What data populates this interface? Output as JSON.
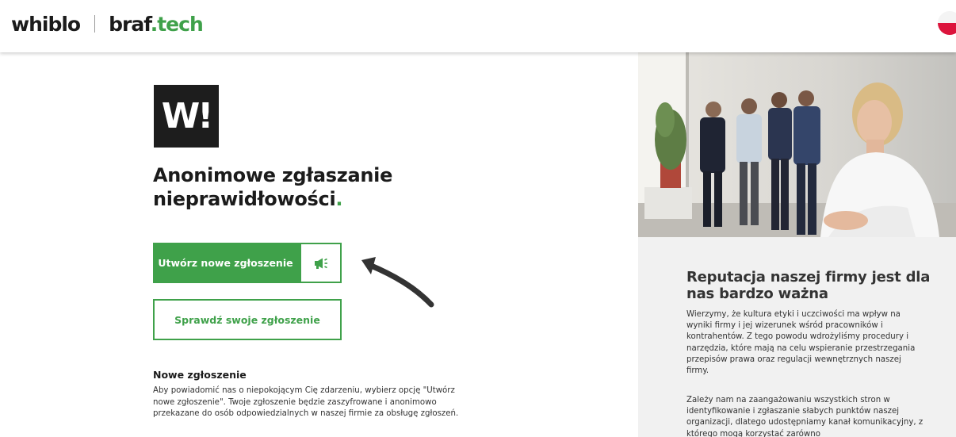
{
  "header": {
    "brand_whiblo": "whiblo",
    "brand_braf": "braf",
    "brand_tech": "tech",
    "language_flag": "poland-flag-icon"
  },
  "hero": {
    "logo_text": "W!",
    "title": "Anonimowe zgłaszanie nieprawidłowości",
    "title_dot": "."
  },
  "actions": {
    "new_report_label": "Utwórz nowe zgłoszenie",
    "new_report_icon": "megaphone-icon",
    "check_report_label": "Sprawdź swoje zgłoszenie"
  },
  "new_report_info": {
    "title": "Nowe zgłoszenie",
    "text": "Aby powiadomić nas o niepokojącym Cię zdarzeniu, wybierz opcję \"Utwórz nowe zgłoszenie\". Twoje zgłoszenie będzie zaszyfrowane i anonimowo przekazane do osób odpowiedzialnych w naszej firmie za obsługę zgłoszeń."
  },
  "sidebar": {
    "title": "Reputacja naszej firmy jest dla nas bardzo ważna",
    "paragraph1": "Wierzymy, że kultura etyki i uczciwości ma wpływ na wyniki firmy i jej wizerunek wśród pracowników i kontrahentów. Z tego powodu wdrożyliśmy procedury i narzędzia, które mają na celu wspieranie przestrzegania przepisów prawa oraz regulacji wewnętrznych naszej firmy.",
    "paragraph2": "Zależy nam na zaangażowaniu wszystkich stron w identyfikowanie i zgłaszanie słabych punktów naszej organizacji, dlatego udostępniamy kanał komunikacyjny, z którego mogą korzystać zarówno"
  },
  "colors": {
    "accent": "#3fa14a",
    "dark": "#1d1d1d",
    "panel": "#f1f1f1"
  }
}
